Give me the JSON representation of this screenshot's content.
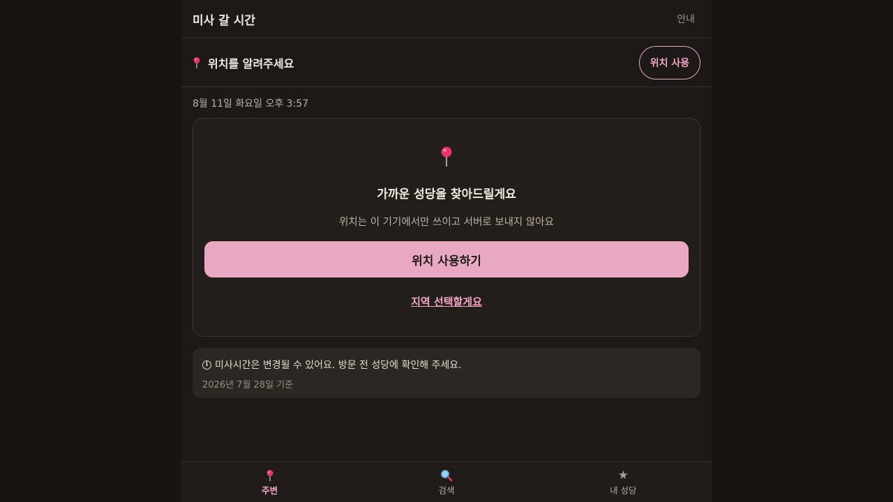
{
  "header": {
    "title": "미사 갈 시간",
    "guide": "안내"
  },
  "location_bar": {
    "icon": "pin-icon",
    "text": "위치를 알려주세요",
    "button": "위치 사용"
  },
  "datetime": "8월 11일 화요일 오후 3:57",
  "card": {
    "icon": "pin-icon",
    "title": "가까운 성당을 찾아드릴게요",
    "description": "위치는 이 기기에서만 쓰이고 서버로 보내지 않아요",
    "primary_button": "위치 사용하기",
    "region_link": "지역 선택할게요"
  },
  "notice": {
    "icon": "info-icon",
    "text": "미사시간은 변경될 수 있어요. 방문 전 성당에 확인해 주세요.",
    "date": "2026년 7월 28일 기준"
  },
  "nav": {
    "items": [
      {
        "label": "주변",
        "icon": "pin-icon",
        "active": true
      },
      {
        "label": "검색",
        "icon": "search-icon",
        "active": false
      },
      {
        "label": "내 성당",
        "icon": "star-icon",
        "active": false
      }
    ]
  },
  "colors": {
    "background": "#171411",
    "accent": "#e9a8c2",
    "accent_text": "#f0a6c4",
    "pin": "#e8336d"
  }
}
